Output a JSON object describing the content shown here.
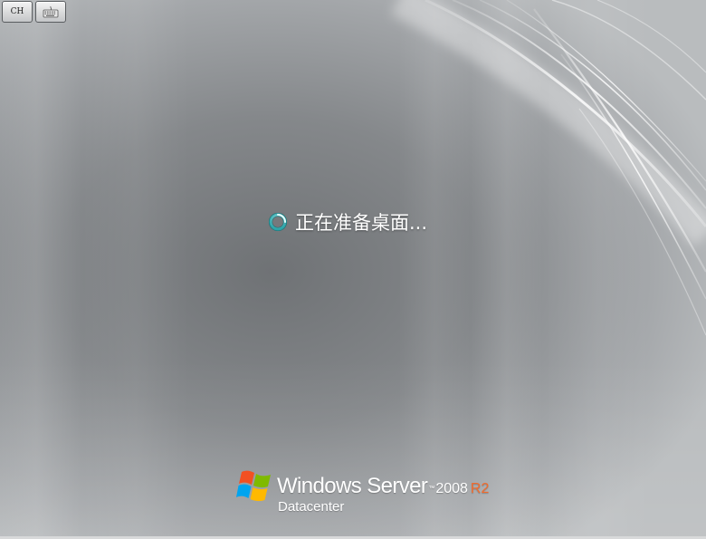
{
  "toolbar": {
    "ime_label": "CH",
    "ime_icon": "language-bar-icon",
    "keyboard_icon": "on-screen-keyboard-icon"
  },
  "status": {
    "text": "正在准备桌面...",
    "icon": "busy-spinner-icon"
  },
  "branding": {
    "product": "Windows Server",
    "trademark": "™",
    "version": "2008",
    "release": "R2",
    "edition": "Datacenter",
    "flag_icon": "windows-flag-icon",
    "colors": {
      "release_accent": "#f26b2c",
      "flag_red": "#f25022",
      "flag_green": "#7fba00",
      "flag_blue": "#00a4ef",
      "flag_yellow": "#ffb900"
    }
  },
  "colors": {
    "background": "#8a8d90",
    "text": "#ffffff",
    "spinner": "#5fd0d0"
  }
}
